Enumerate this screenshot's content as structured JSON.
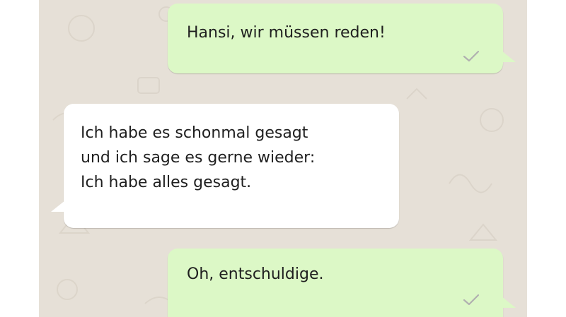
{
  "messages": [
    {
      "direction": "outgoing",
      "text": "Hansi, wir müssen reden!",
      "status": "check-icon"
    },
    {
      "direction": "incoming",
      "text": "Ich habe es schonmal gesagt\nund ich sage es gerne wieder:\nIch habe alles gesagt."
    },
    {
      "direction": "outgoing",
      "text": "Oh, entschuldige.",
      "status": "check-icon"
    }
  ],
  "colors": {
    "chat_background": "#e6e0d7",
    "outgoing_bubble": "#dcf8c6",
    "incoming_bubble": "#ffffff",
    "check": "#b0b0b0"
  }
}
